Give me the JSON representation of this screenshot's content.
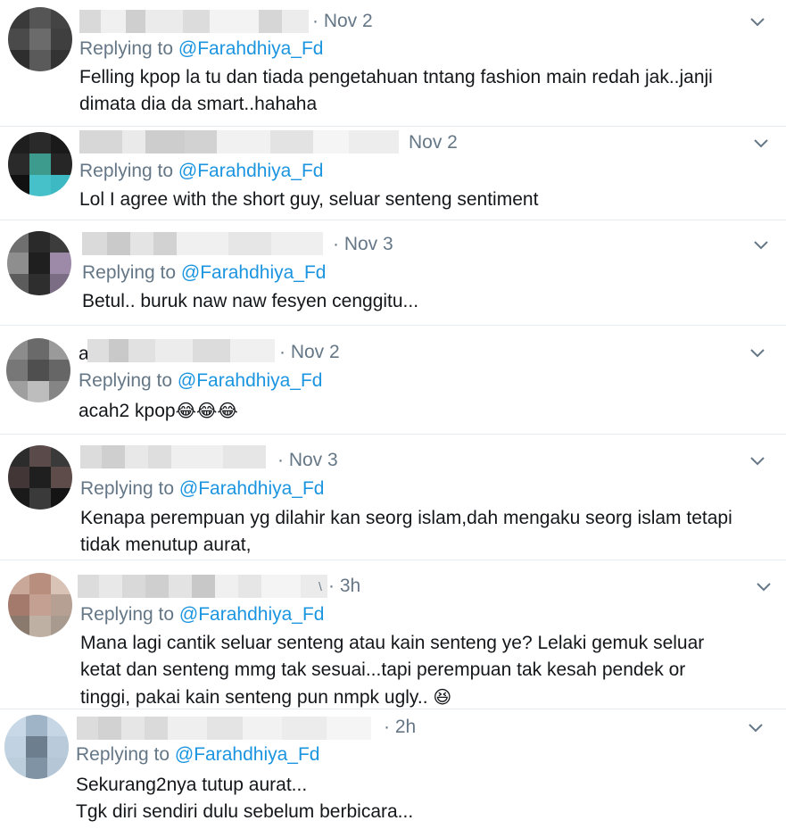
{
  "reply_prefix": "Replying to",
  "reply_handle": "@Farahdhiya_Fd",
  "tweets": [
    {
      "date": "· Nov 2",
      "lines": [
        "Felling kpop la tu dan tiada pengetahuan tntang fashion main redah jak..janji",
        "dimata dia da smart..hahaha"
      ]
    },
    {
      "date": "Nov 2",
      "lines": [
        "Lol I agree with the short guy, seluar senteng sentiment"
      ]
    },
    {
      "date": "· Nov 3",
      "lines": [
        "Betul.. buruk naw naw fesyen cenggitu..."
      ]
    },
    {
      "name_initial": "a",
      "date": "· Nov 2",
      "lines": [
        "acah2 kpop"
      ],
      "emoji": "😂😂😂"
    },
    {
      "date": "· Nov 3",
      "lines": [
        "Kenapa perempuan yg dilahir kan seorg islam,dah mengaku seorg islam tetapi",
        "tidak menutup aurat,"
      ]
    },
    {
      "name_tail": "\\",
      "date": "· 3h",
      "lines": [
        "Mana lagi cantik seluar senteng atau kain senteng ye? Lelaki gemuk seluar",
        "ketat dan senteng mmg tak sesuai...tapi perempuan tak kesah pendek or",
        "tinggi, pakai kain senteng pun nmpk ugly.."
      ],
      "emoji": "😆"
    },
    {
      "date": "· 2h",
      "lines": [
        "Sekurang2nya tutup aurat...",
        "Tgk diri sendiri dulu sebelum berbicara..."
      ]
    }
  ],
  "icons": {
    "chevron": "chevron-down-icon",
    "avatar": "avatar-pixelated"
  },
  "colors": {
    "link": "#1b95e0",
    "secondary": "#657786",
    "text": "#14171a"
  }
}
